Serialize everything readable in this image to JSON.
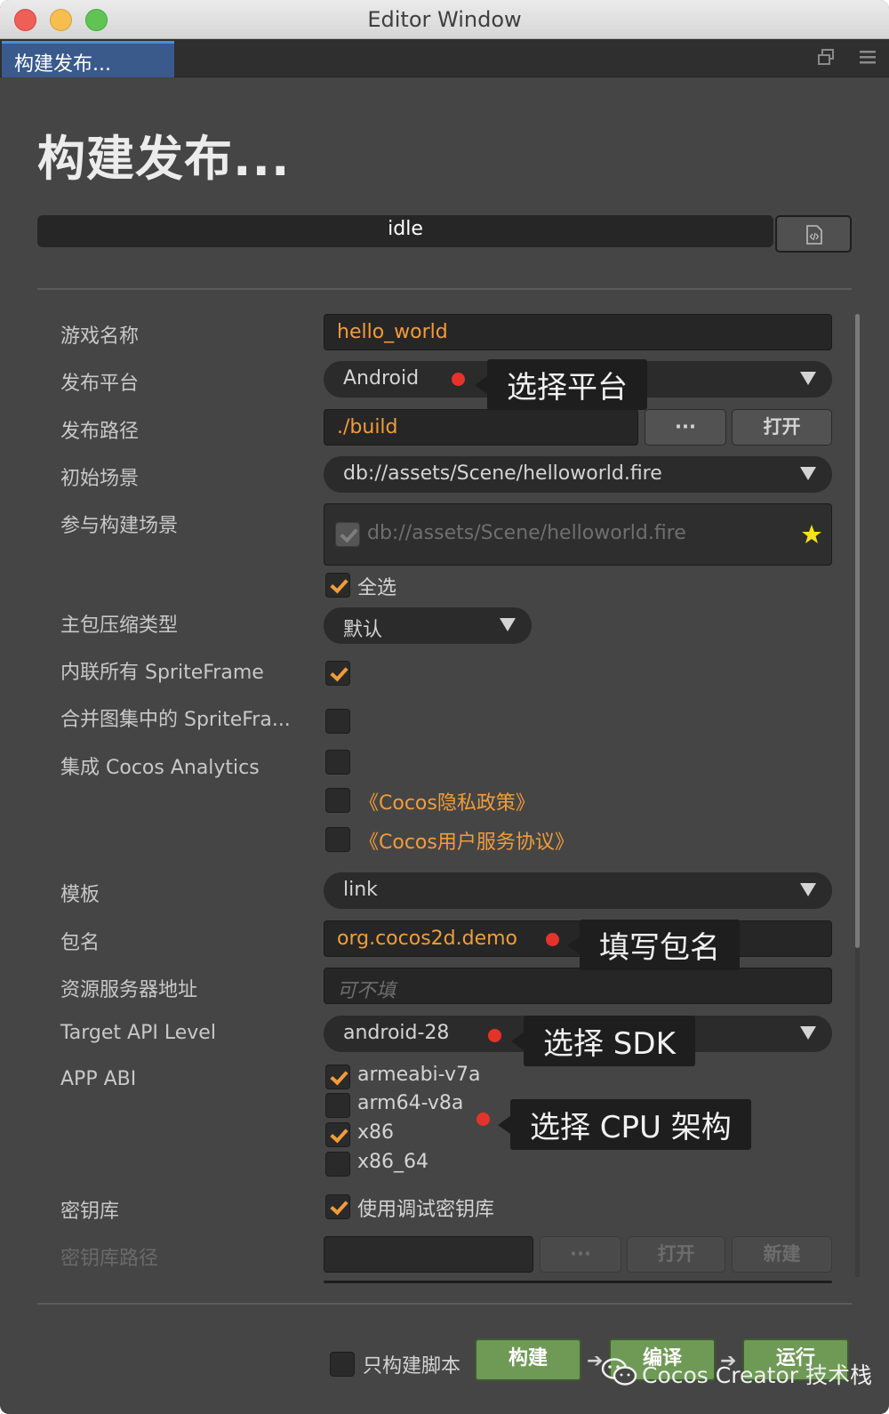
{
  "window": {
    "title": "Editor Window"
  },
  "tab": {
    "label": "构建发布..."
  },
  "panel": {
    "heading": "构建发布...",
    "status": "idle"
  },
  "form": {
    "game_name": {
      "label": "游戏名称",
      "value": "hello_world"
    },
    "platform": {
      "label": "发布平台",
      "value": "Android"
    },
    "build_path": {
      "label": "发布路径",
      "value": "./build",
      "browse": "···",
      "open": "打开"
    },
    "start_scene": {
      "label": "初始场景",
      "value": "db://assets/Scene/helloworld.fire"
    },
    "included_scenes": {
      "label": "参与构建场景",
      "scene": "db://assets/Scene/helloworld.fire",
      "select_all": "全选"
    },
    "compression": {
      "label": "主包压缩类型",
      "value": "默认"
    },
    "inline_spriteframe": {
      "label": "内联所有 SpriteFrame"
    },
    "merge_spriteframe": {
      "label": "合并图集中的 SpriteFra..."
    },
    "analytics": {
      "label": "集成 Cocos Analytics",
      "privacy": "《Cocos隐私政策》",
      "service": "《Cocos用户服务协议》"
    },
    "template": {
      "label": "模板",
      "value": "link"
    },
    "package_name": {
      "label": "包名",
      "value": "org.cocos2d.demo"
    },
    "remote_server": {
      "label": "资源服务器地址",
      "placeholder": "可不填"
    },
    "target_api": {
      "label": "Target API Level",
      "value": "android-28"
    },
    "app_abi": {
      "label": "APP ABI",
      "options": [
        "armeabi-v7a",
        "arm64-v8a",
        "x86",
        "x86_64"
      ]
    },
    "keystore": {
      "label": "密钥库",
      "debug": "使用调试密钥库"
    },
    "keystore_path": {
      "label": "密钥库路径",
      "browse": "···",
      "open": "打开",
      "new": "新建"
    }
  },
  "footer": {
    "script_only": "只构建脚本",
    "build": "构建",
    "compile": "编译",
    "run": "运行",
    "watermark": "Cocos Creator 技术栈"
  },
  "callouts": {
    "platform": "选择平台",
    "package": "填写包名",
    "sdk": "选择 SDK",
    "cpu": "选择 CPU 架构"
  },
  "colors": {
    "accent": "#f39c38",
    "background": "#454545",
    "callout_dot": "#e6332a",
    "build_button": "#6e9a55"
  }
}
